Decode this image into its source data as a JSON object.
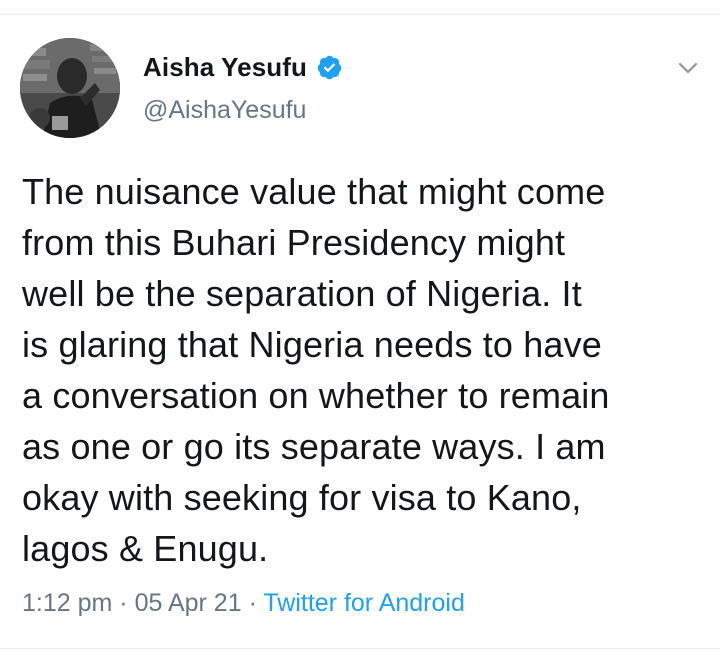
{
  "tweet": {
    "author": {
      "display_name": "Aisha Yesufu",
      "handle": "@AishaYesufu",
      "verified": true,
      "avatar_icon": "profile-photo"
    },
    "text_lines": [
      "The nuisance value that might come",
      "from this Buhari Presidency might",
      "well be the separation of Nigeria. It",
      "is glaring that Nigeria needs to have",
      "a conversation on whether to remain",
      "as one or go its separate ways. I am",
      "okay with seeking for visa to Kano,",
      "lagos & Enugu."
    ],
    "time": "1:12 pm",
    "date": "05 Apr 21",
    "separator": "·",
    "source": "Twitter for Android"
  },
  "icons": {
    "verified": "verified-badge-icon",
    "menu": "chevron-down-icon"
  },
  "colors": {
    "verified_blue": "#1da1f2",
    "text": "#14171a",
    "secondary_text": "#657786",
    "link": "#1da1f2",
    "divider": "#e6ecf0"
  }
}
